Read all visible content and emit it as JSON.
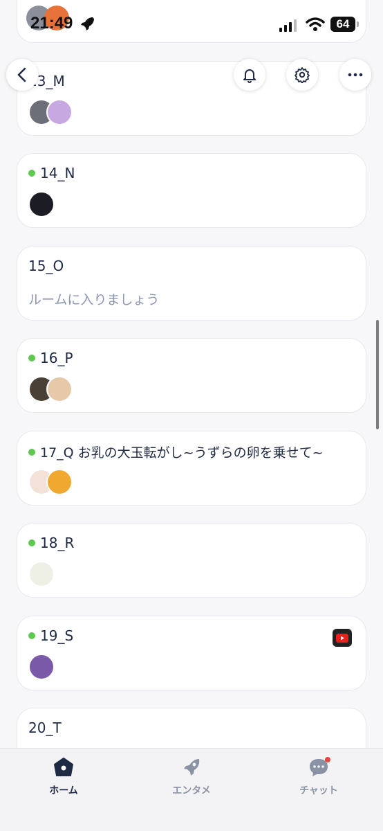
{
  "status_bar": {
    "time": "21:49",
    "battery": "64"
  },
  "rooms": [
    {
      "name": "13_M",
      "active": false
    },
    {
      "name": "14_N",
      "active": true
    },
    {
      "name": "15_O",
      "active": false,
      "subtitle": "ルームに入りましょう"
    },
    {
      "name": "16_P",
      "active": true
    },
    {
      "name": "17_Q お乳の大玉転がし~うずらの卵を乗せて~",
      "active": true
    },
    {
      "name": "18_R",
      "active": true
    },
    {
      "name": "19_S",
      "active": true,
      "badge_icon": "youtube-icon"
    },
    {
      "name": "20_T",
      "active": false
    }
  ],
  "tabs": [
    {
      "label": "ホーム",
      "icon": "home-icon",
      "active": true
    },
    {
      "label": "エンタメ",
      "icon": "rocket-icon",
      "active": false
    },
    {
      "label": "チャット",
      "icon": "chat-icon",
      "active": false
    }
  ],
  "colors": {
    "active_dot": "#5dc94f",
    "text": "#1f2a44",
    "muted": "#8b97b2",
    "notify": "#e5483f"
  }
}
